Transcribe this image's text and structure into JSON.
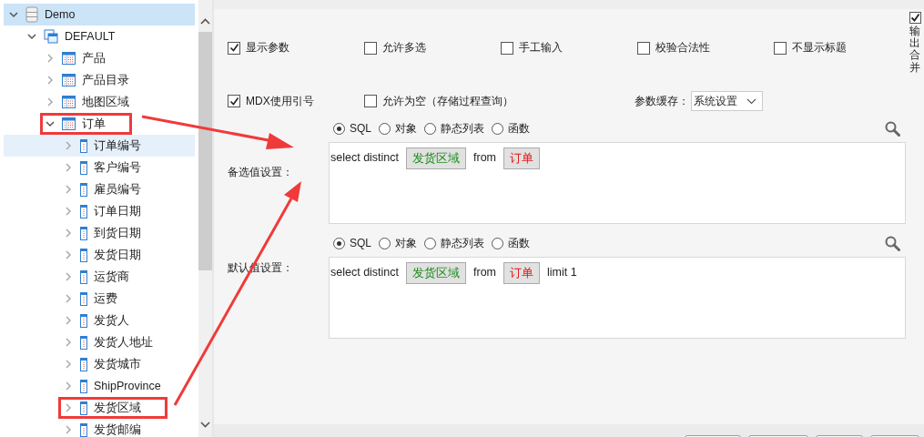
{
  "tree": [
    {
      "label": "Demo",
      "kind": "database",
      "expanded": true,
      "selected": true,
      "hovered": false,
      "annotated": false,
      "children": [
        {
          "label": "DEFAULT",
          "kind": "schema",
          "expanded": true,
          "selected": false,
          "hovered": false,
          "annotated": false,
          "children": [
            {
              "label": "产品",
              "kind": "table",
              "expanded": false,
              "selected": false,
              "hovered": false,
              "annotated": false
            },
            {
              "label": "产品目录",
              "kind": "table",
              "expanded": false,
              "selected": false,
              "hovered": false,
              "annotated": false
            },
            {
              "label": "地图区域",
              "kind": "table",
              "expanded": false,
              "selected": false,
              "hovered": false,
              "annotated": false
            },
            {
              "label": "订单",
              "kind": "table",
              "expanded": true,
              "selected": false,
              "hovered": false,
              "annotated": true,
              "children": [
                {
                  "label": "订单编号",
                  "kind": "column",
                  "expanded": false,
                  "selected": false,
                  "hovered": true,
                  "annotated": false
                },
                {
                  "label": "客户编号",
                  "kind": "column",
                  "expanded": false,
                  "selected": false,
                  "hovered": false,
                  "annotated": false
                },
                {
                  "label": "雇员编号",
                  "kind": "column",
                  "expanded": false,
                  "selected": false,
                  "hovered": false,
                  "annotated": false
                },
                {
                  "label": "订单日期",
                  "kind": "column",
                  "expanded": false,
                  "selected": false,
                  "hovered": false,
                  "annotated": false
                },
                {
                  "label": "到货日期",
                  "kind": "column",
                  "expanded": false,
                  "selected": false,
                  "hovered": false,
                  "annotated": false
                },
                {
                  "label": "发货日期",
                  "kind": "column",
                  "expanded": false,
                  "selected": false,
                  "hovered": false,
                  "annotated": false
                },
                {
                  "label": "运货商",
                  "kind": "column",
                  "expanded": false,
                  "selected": false,
                  "hovered": false,
                  "annotated": false
                },
                {
                  "label": "运费",
                  "kind": "column",
                  "expanded": false,
                  "selected": false,
                  "hovered": false,
                  "annotated": false
                },
                {
                  "label": "发货人",
                  "kind": "column",
                  "expanded": false,
                  "selected": false,
                  "hovered": false,
                  "annotated": false
                },
                {
                  "label": "发货人地址",
                  "kind": "column",
                  "expanded": false,
                  "selected": false,
                  "hovered": false,
                  "annotated": false
                },
                {
                  "label": "发货城市",
                  "kind": "column",
                  "expanded": false,
                  "selected": false,
                  "hovered": false,
                  "annotated": false
                },
                {
                  "label": "ShipProvince",
                  "kind": "column",
                  "expanded": false,
                  "selected": false,
                  "hovered": false,
                  "annotated": false
                },
                {
                  "label": "发货区域",
                  "kind": "column",
                  "expanded": false,
                  "selected": false,
                  "hovered": false,
                  "annotated": true
                },
                {
                  "label": "发货邮编",
                  "kind": "column",
                  "expanded": false,
                  "selected": false,
                  "hovered": false,
                  "annotated": false
                }
              ]
            }
          ]
        }
      ]
    }
  ],
  "options_row_1": [
    {
      "label": "显示参数",
      "checked": true
    },
    {
      "label": "允许多选",
      "checked": false
    },
    {
      "label": "手工输入",
      "checked": false
    },
    {
      "label": "校验合法性",
      "checked": false
    },
    {
      "label": "不显示标题",
      "checked": false
    }
  ],
  "options_row_2": [
    {
      "label": "MDX使用引号",
      "checked": true
    },
    {
      "label": "允许为空（存储过程查询）",
      "checked": false
    }
  ],
  "param_cache": {
    "label": "参数缓存：",
    "value": "系统设置"
  },
  "output_merge": {
    "label": "输出合并",
    "checked": true
  },
  "sections": [
    {
      "label": "备选值设置：",
      "sources": [
        {
          "label": "SQL",
          "selected": true
        },
        {
          "label": "对象",
          "selected": false
        },
        {
          "label": "静态列表",
          "selected": false
        },
        {
          "label": "函数",
          "selected": false
        }
      ],
      "expression": [
        {
          "kind": "text",
          "text": "select distinct"
        },
        {
          "kind": "field",
          "text": "发货区域"
        },
        {
          "kind": "text",
          "text": "from"
        },
        {
          "kind": "table",
          "text": "订单"
        }
      ]
    },
    {
      "label": "默认值设置：",
      "sources": [
        {
          "label": "SQL",
          "selected": true
        },
        {
          "label": "对象",
          "selected": false
        },
        {
          "label": "静态列表",
          "selected": false
        },
        {
          "label": "函数",
          "selected": false
        }
      ],
      "expression": [
        {
          "kind": "text",
          "text": "select distinct"
        },
        {
          "kind": "field",
          "text": "发货区域"
        },
        {
          "kind": "text",
          "text": "from"
        },
        {
          "kind": "table",
          "text": "订单"
        },
        {
          "kind": "text",
          "text": "limit 1"
        }
      ]
    }
  ]
}
